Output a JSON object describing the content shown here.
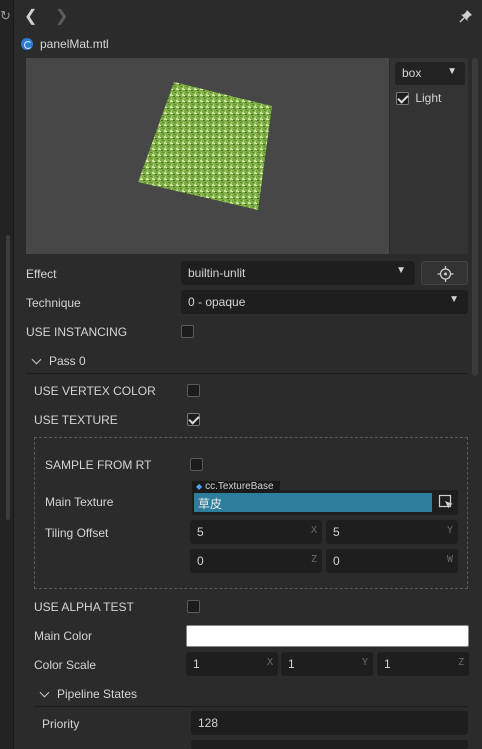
{
  "toolbar": {
    "back_icon": "chevron-left-icon",
    "forward_icon": "chevron-right-icon",
    "pin_icon": "pin-icon"
  },
  "file": {
    "name": "panelMat.mtl",
    "icon": "material-file-icon"
  },
  "preview": {
    "mesh_select": "box",
    "light_label": "Light",
    "light_checked": true
  },
  "effect": {
    "label": "Effect",
    "value": "builtin-unlit"
  },
  "technique": {
    "label": "Technique",
    "value": "0 - opaque"
  },
  "use_instancing": {
    "label": "USE INSTANCING",
    "checked": false
  },
  "pass": {
    "label": "Pass 0",
    "use_vertex_color": {
      "label": "USE VERTEX COLOR",
      "checked": false
    },
    "use_texture": {
      "label": "USE TEXTURE",
      "checked": true
    },
    "sample_from_rt": {
      "label": "SAMPLE FROM RT",
      "checked": false
    },
    "main_texture": {
      "label": "Main Texture",
      "type_tag": "cc.TextureBase",
      "value": "草皮"
    },
    "tiling_offset": {
      "label": "Tiling Offset",
      "x": "5",
      "y": "5",
      "z": "0",
      "w": "0"
    },
    "use_alpha_test": {
      "label": "USE ALPHA TEST",
      "checked": false
    },
    "main_color": {
      "label": "Main Color",
      "color": "#ffffff"
    },
    "color_scale": {
      "label": "Color Scale",
      "x": "1",
      "y": "1",
      "z": "1"
    },
    "pipeline_states": {
      "label": "Pipeline States",
      "priority_label": "Priority",
      "priority_value": "128"
    }
  },
  "axis_letters": {
    "x": "X",
    "y": "Y",
    "z": "Z",
    "w": "W"
  },
  "colors": {
    "panel_bg": "#2b2b2b",
    "field_bg": "#1e1e1e",
    "texture_highlight": "#2d7e9d",
    "grass": "#8ab84a"
  }
}
